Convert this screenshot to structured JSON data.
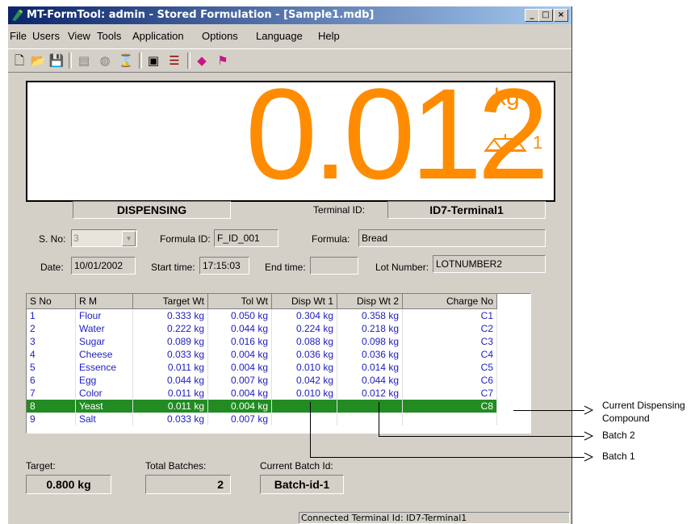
{
  "window": {
    "title": "MT-FormTool: admin - Stored Formulation - [Sample1.mdb]"
  },
  "menu": [
    "File",
    "Users",
    "View",
    "Tools",
    "Application",
    "Options",
    "Language",
    "Help"
  ],
  "display": {
    "weight": "0.012",
    "unit": "kg",
    "scale_number": "1"
  },
  "status": {
    "mode": "DISPENSING",
    "terminal_label": "Terminal ID:",
    "terminal_value": "ID7-Terminal1"
  },
  "form": {
    "sno_label": "S. No:",
    "sno_value": "3",
    "formula_id_label": "Formula ID:",
    "formula_id_value": "F_ID_001",
    "formula_label": "Formula:",
    "formula_value": "Bread",
    "date_label": "Date:",
    "date_value": "10/01/2002",
    "start_label": "Start time:",
    "start_value": "17:15:03",
    "end_label": "End time:",
    "end_value": "",
    "lot_label": "Lot Number:",
    "lot_value": "LOTNUMBER2"
  },
  "table": {
    "headers": [
      "S No",
      "R M",
      "Target Wt",
      "Tol Wt",
      "Disp Wt 1",
      "Disp Wt 2",
      "Charge No"
    ],
    "rows": [
      [
        "1",
        "Flour",
        "0.333 kg",
        "0.050 kg",
        "0.304 kg",
        "0.358 kg",
        "C1"
      ],
      [
        "2",
        "Water",
        "0.222 kg",
        "0.044 kg",
        "0.224 kg",
        "0.218 kg",
        "C2"
      ],
      [
        "3",
        "Sugar",
        "0.089 kg",
        "0.016 kg",
        "0.088 kg",
        "0.098 kg",
        "C3"
      ],
      [
        "4",
        "Cheese",
        "0.033 kg",
        "0.004 kg",
        "0.036 kg",
        "0.036 kg",
        "C4"
      ],
      [
        "5",
        "Essence",
        "0.011 kg",
        "0.004 kg",
        "0.010 kg",
        "0.014 kg",
        "C5"
      ],
      [
        "6",
        "Egg",
        "0.044 kg",
        "0.007 kg",
        "0.042 kg",
        "0.044 kg",
        "C6"
      ],
      [
        "7",
        "Color",
        "0.011 kg",
        "0.004 kg",
        "0.010 kg",
        "0.012 kg",
        "C7"
      ],
      [
        "8",
        "Yeast",
        "0.011 kg",
        "0.004 kg",
        "",
        "",
        "C8"
      ],
      [
        "9",
        "Salt",
        "0.033 kg",
        "0.007 kg",
        "",
        "",
        ""
      ]
    ],
    "selected_row": 7
  },
  "footer": {
    "target_label": "Target:",
    "target_value": "0.800 kg",
    "batches_label": "Total Batches:",
    "batches_value": "2",
    "batch_id_label": "Current Batch Id:",
    "batch_id_value": "Batch-id-1"
  },
  "statusbar": {
    "text": "Connected Terminal Id: ID7-Terminal1"
  },
  "callouts": {
    "current": "Current Dispensing Compound",
    "batch2": "Batch 2",
    "batch1": "Batch 1"
  },
  "colors": {
    "display_digits": "#ff8c00",
    "selected_row": "#228b22",
    "grid_text": "#2020c0"
  }
}
